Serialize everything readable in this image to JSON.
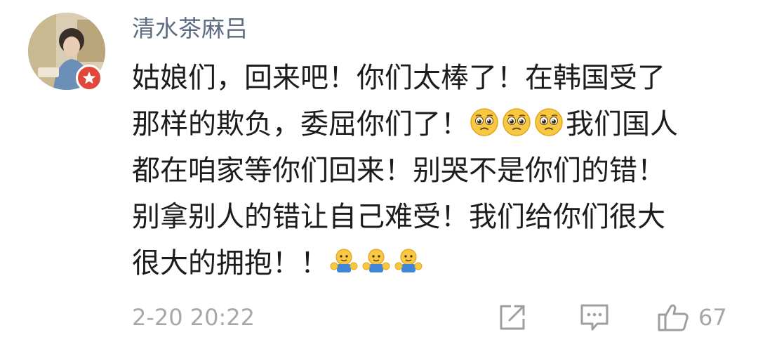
{
  "comment": {
    "username": "清水茶麻吕",
    "lines": [
      "姑娘们，回来吧！你们太棒了！在韩国受了",
      "那样的欺负，委屈你们了！",
      "我们国人",
      "都在咱家等你们回来！别哭不是你们的错！",
      "别拿别人的错让自己难受！我们给你们很大",
      "很大的拥抱！！"
    ],
    "timestamp": "2-20 20:22",
    "like_count": "67",
    "emojis": {
      "line2": [
        "pleading-face-icon",
        "pleading-face-icon",
        "pleading-face-icon"
      ],
      "line6": [
        "hug-icon",
        "hug-icon",
        "hug-icon"
      ]
    }
  },
  "colors": {
    "username": "#5f6c85",
    "text": "#1c1c1c",
    "meta": "#a7a7a7",
    "badge": "#e2473b"
  }
}
